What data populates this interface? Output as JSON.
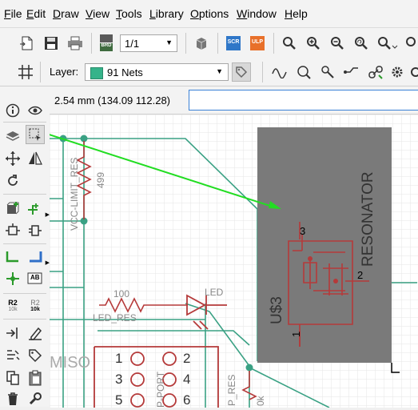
{
  "menu": [
    "File",
    "Edit",
    "Draw",
    "View",
    "Tools",
    "Library",
    "Options",
    "Window",
    "Help"
  ],
  "menu_mnemonics": [
    "F",
    "E",
    "D",
    "V",
    "T",
    "L",
    "O",
    "W",
    "H"
  ],
  "toolbar": {
    "sheet_value": "1/1",
    "scr_label": "SCR",
    "ulp_label": "ULP",
    "brd_label": "BRD"
  },
  "layer": {
    "label": "Layer:",
    "value": "91 Nets",
    "color": "#35b38a"
  },
  "coords": {
    "readout": "2.54 mm (134.09 112.28)",
    "command_value": ""
  },
  "left_tools": {
    "r2_label": "R2",
    "r2_sub": "10k",
    "r2b_sub": "10k",
    "ab_label": "AB"
  },
  "schematic": {
    "labels": {
      "vcc_limit_res": "VCC-LIMIT_RES",
      "r499": "499",
      "r100": "100",
      "led_res": "LED_RES",
      "led": "LED",
      "resonator": "RESONATOR",
      "u3": "U$3",
      "pin3": "3",
      "pin2": "2",
      "pin1": "1",
      "miso": "MISO",
      "isp_port": "P-PORT",
      "p_res": "P_RES",
      "p_res_val": "0k",
      "h1": "1",
      "h2": "2",
      "h3": "3",
      "h4": "4",
      "h5": "5",
      "h6": "6"
    },
    "colors": {
      "net": "#3aa184",
      "part": "#b53a3a",
      "grid": "#e5e5e5",
      "selection": "#7a7a7a",
      "arrow": "#22dd22"
    }
  }
}
